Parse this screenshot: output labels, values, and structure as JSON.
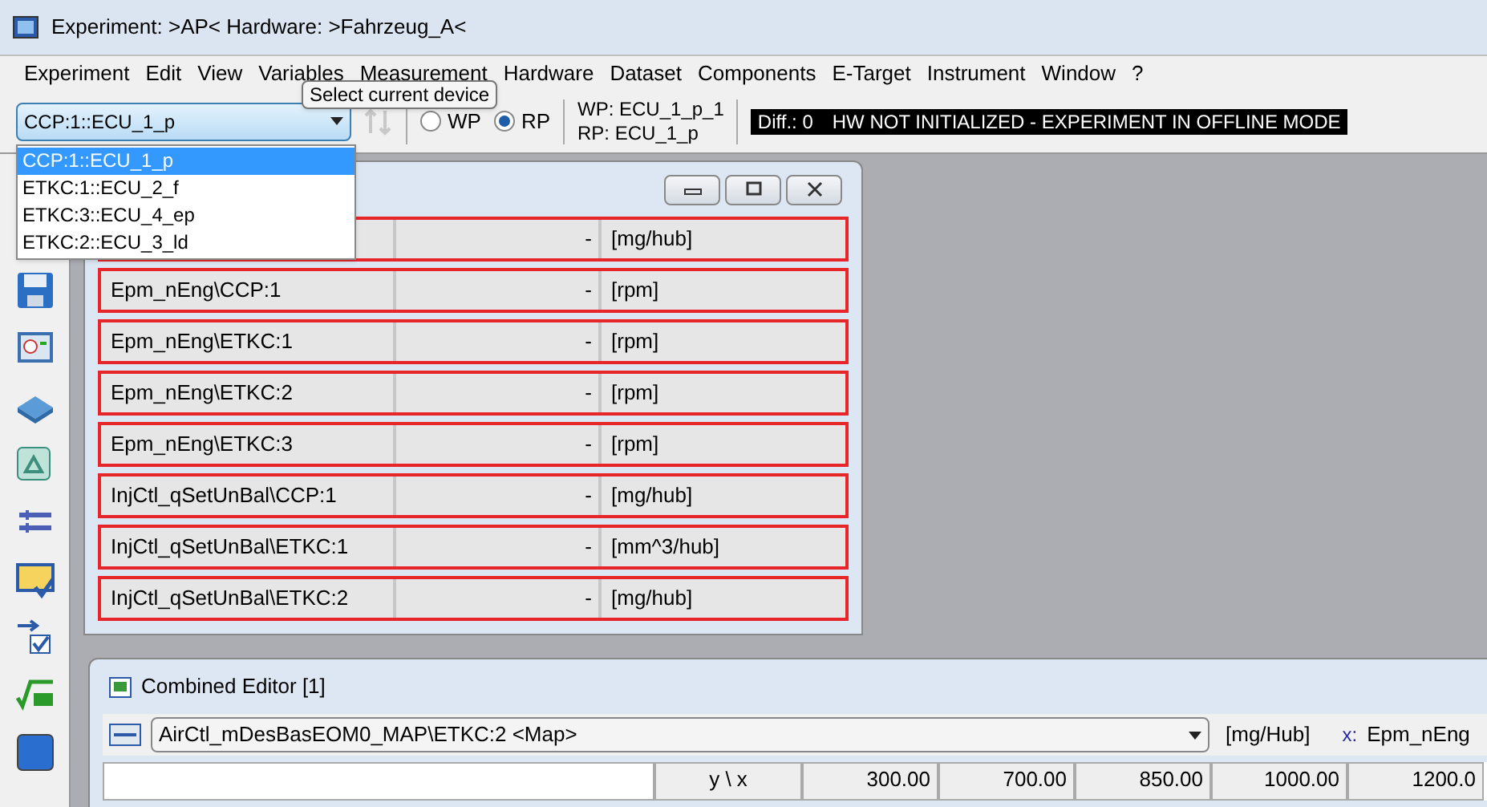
{
  "window": {
    "title": "Experiment: >AP< Hardware: >Fahrzeug_A<"
  },
  "menu": [
    "Experiment",
    "Edit",
    "View",
    "Variables",
    "Measurement",
    "Hardware",
    "Dataset",
    "Components",
    "E-Target",
    "Instrument",
    "Window",
    "?"
  ],
  "toolbar": {
    "device_select": {
      "value": "CCP:1::ECU_1_p",
      "options": [
        {
          "label": "CCP:1::ECU_1_p",
          "selected": true
        },
        {
          "label": "ETKC:1::ECU_2_f",
          "selected": false
        },
        {
          "label": "ETKC:3::ECU_4_ep",
          "selected": false
        },
        {
          "label": "ETKC:2::ECU_3_ld",
          "selected": false
        }
      ]
    },
    "tooltip": "Select current device",
    "page_radios": [
      {
        "label": "WP",
        "selected": false
      },
      {
        "label": "RP",
        "selected": true
      }
    ],
    "wp_label": "WP: ECU_1_p_1",
    "rp_label": "RP: ECU_1_p",
    "status": {
      "diff": "Diff.: 0",
      "message": "HW NOT INITIALIZED - EXPERIMENT IN OFFLINE MODE"
    }
  },
  "variable_window": {
    "rows": [
      {
        "value": "-",
        "unit": "[mg/hub]"
      },
      {
        "name": "Epm_nEng\\CCP:1",
        "value": "-",
        "unit": "[rpm]"
      },
      {
        "name": "Epm_nEng\\ETKC:1",
        "value": "-",
        "unit": "[rpm]"
      },
      {
        "name": "Epm_nEng\\ETKC:2",
        "value": "-",
        "unit": "[rpm]"
      },
      {
        "name": "Epm_nEng\\ETKC:3",
        "value": "-",
        "unit": "[rpm]"
      },
      {
        "name": "InjCtl_qSetUnBal\\CCP:1",
        "value": "-",
        "unit": "[mg/hub]"
      },
      {
        "name": "InjCtl_qSetUnBal\\ETKC:1",
        "value": "-",
        "unit": "[mm^3/hub]"
      },
      {
        "name": "InjCtl_qSetUnBal\\ETKC:2",
        "value": "-",
        "unit": "[mg/hub]"
      }
    ]
  },
  "combined_editor": {
    "title": "Combined Editor [1]",
    "variable": "AirCtl_mDesBasEOM0_MAP\\ETKC:2 <Map>",
    "unit": "[mg/Hub]",
    "x_label": "x:",
    "x_name": "Epm_nEng",
    "corner": "y \\ x",
    "x_values": [
      "300.00",
      "700.00",
      "850.00",
      "1000.00",
      "1200.0"
    ]
  }
}
